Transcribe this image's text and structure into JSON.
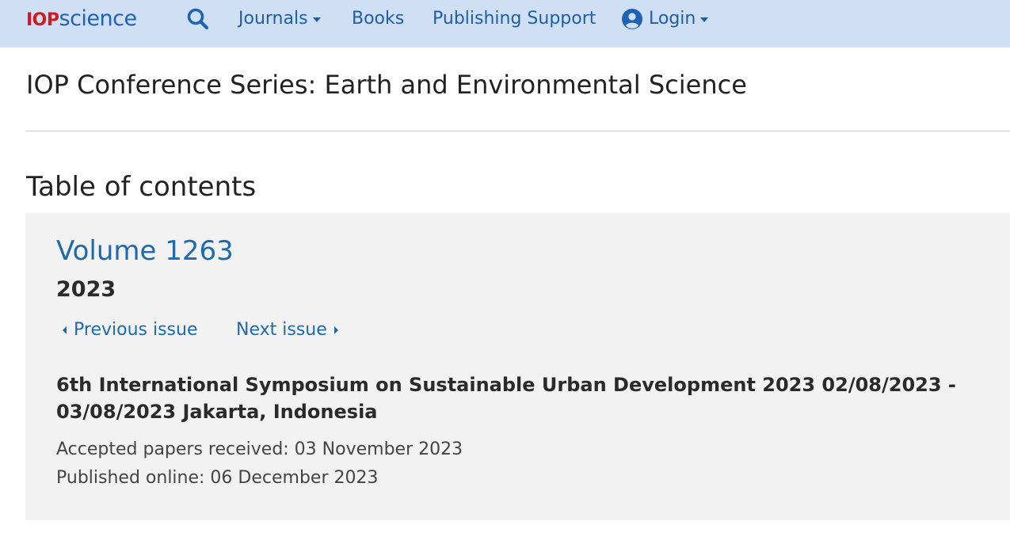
{
  "header": {
    "logo_iop": "IOP",
    "logo_science": "science",
    "nav": {
      "journals": "Journals",
      "books": "Books",
      "publishing_support": "Publishing Support",
      "login": "Login"
    },
    "icons": {
      "search": "search-icon",
      "user": "user-circle-icon"
    }
  },
  "journal_title": "IOP Conference Series: Earth and Environmental Science",
  "toc_heading": "Table of contents",
  "issue": {
    "volume": "Volume 1263",
    "year": "2023",
    "prev_label": "Previous issue",
    "next_label": "Next issue",
    "conference": "6th International Symposium on Sustainable Urban Development 2023 02/08/2023 - 03/08/2023 Jakarta, Indonesia",
    "accepted": "Accepted papers received: 03 November 2023",
    "published": "Published online: 06 December 2023"
  },
  "colors": {
    "topbar_bg": "#cfe0f5",
    "link": "#1e6aaa",
    "logo_red": "#d01c1f",
    "logo_blue": "#1e62b6",
    "panel_bg": "#f2f2f2"
  }
}
